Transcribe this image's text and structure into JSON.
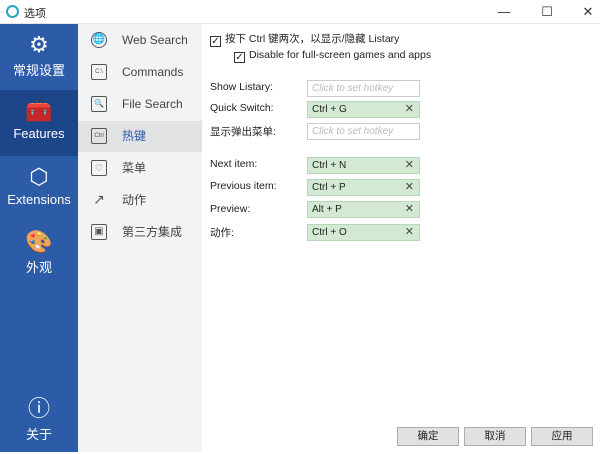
{
  "window": {
    "title": "选项",
    "minimize": "—",
    "maximize": "☐",
    "close": "✕"
  },
  "sidebar": [
    {
      "label": "常规设置",
      "icon": "gear-icon",
      "glyph": "⚙"
    },
    {
      "label": "Features",
      "icon": "toolbox-icon",
      "glyph": "🧰"
    },
    {
      "label": "Extensions",
      "icon": "cubes-icon",
      "glyph": "⬡"
    },
    {
      "label": "外观",
      "icon": "palette-icon",
      "glyph": "🎨"
    },
    {
      "label": "关于",
      "icon": "info-icon",
      "glyph": "ⓘ"
    }
  ],
  "nav": [
    {
      "label": "Web Search",
      "glyph": "🌐"
    },
    {
      "label": "Commands",
      "glyph": "C:\\"
    },
    {
      "label": "File Search",
      "glyph": "🔍"
    },
    {
      "label": "热键",
      "glyph": "Ctrl"
    },
    {
      "label": "菜单",
      "glyph": "♡"
    },
    {
      "label": "动作",
      "glyph": "↗"
    },
    {
      "label": "第三方集成",
      "glyph": "▣"
    }
  ],
  "options": {
    "double_ctrl": {
      "label": "按下 Ctrl 键两次，以显示/隐藏 Listary",
      "checked": true
    },
    "disable_fullscreen": {
      "label": "Disable for full-screen games and apps",
      "checked": true
    }
  },
  "hotkeys": [
    {
      "label": "Show Listary:",
      "value": "",
      "placeholder": "Click to set hotkey"
    },
    {
      "label": "Quick Switch:",
      "value": "Ctrl + G"
    },
    {
      "label": "显示弹出菜单:",
      "value": "",
      "placeholder": "Click to set hotkey"
    },
    {
      "label": "Next item:",
      "value": "Ctrl + N"
    },
    {
      "label": "Previous item:",
      "value": "Ctrl + P"
    },
    {
      "label": "Preview:",
      "value": "Alt + P"
    },
    {
      "label": "动作:",
      "value": "Ctrl + O"
    }
  ],
  "clear_glyph": "✕",
  "check_glyph": "✓",
  "buttons": {
    "ok": "确定",
    "cancel": "取消",
    "apply": "应用"
  }
}
